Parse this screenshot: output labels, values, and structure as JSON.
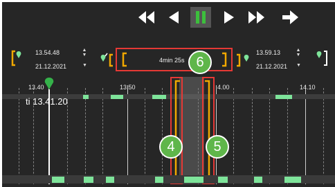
{
  "colors": {
    "background": "#262626",
    "accent_green": "#7ee49a",
    "pause_green": "#3cbf3c",
    "bracket_orange": "#f0a800",
    "highlight_red": "#e53935",
    "badge_green": "#5fb64a"
  },
  "playback": {
    "buttons": [
      {
        "name": "rewind-button",
        "icon": "fast-rewind-icon"
      },
      {
        "name": "step-back-button",
        "icon": "play-reverse-icon"
      },
      {
        "name": "pause-button",
        "icon": "pause-icon",
        "active": true
      },
      {
        "name": "play-button",
        "icon": "play-icon"
      },
      {
        "name": "fast-forward-button",
        "icon": "fast-forward-icon"
      },
      {
        "name": "go-live-button",
        "icon": "arrow-right-icon"
      }
    ]
  },
  "start": {
    "time": "13.54.48",
    "date": "21.12.2021"
  },
  "end": {
    "time": "13.59.13",
    "date": "21.12.2021"
  },
  "duration": {
    "text": "4min 25s"
  },
  "timeline": {
    "tick_labels": [
      "13.40",
      "13.50",
      "14.00",
      "14.10"
    ],
    "cursor_label": "ti 13.41.20",
    "visible_tick_text_14": "4.00"
  },
  "callouts": {
    "badge_4": "4",
    "badge_5": "5",
    "badge_6": "6"
  }
}
